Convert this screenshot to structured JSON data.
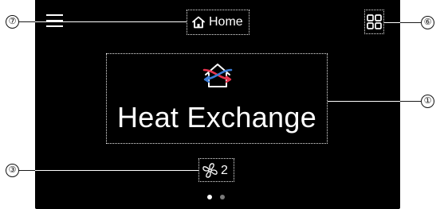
{
  "header": {
    "home_label": "Home",
    "menu_icon": "hamburger-menu-icon",
    "grid_icon": "grid-apps-icon",
    "home_icon": "home-icon"
  },
  "main": {
    "mode_label": "Heat Exchange",
    "mode_icon": "heat-exchange-icon"
  },
  "fan": {
    "speed": "2",
    "icon": "fan-icon"
  },
  "pagination": {
    "pages": 2,
    "active_index": 0
  },
  "callouts": {
    "home": "⑦",
    "grid": "⑥",
    "mode": "①",
    "fan": "③"
  },
  "colors": {
    "screen_bg": "#000000",
    "text": "#ffffff",
    "icon_red": "#e8344e",
    "icon_blue": "#3a7bd5",
    "dot_active": "#ffffff",
    "dot_inactive": "#7a7a7a"
  }
}
